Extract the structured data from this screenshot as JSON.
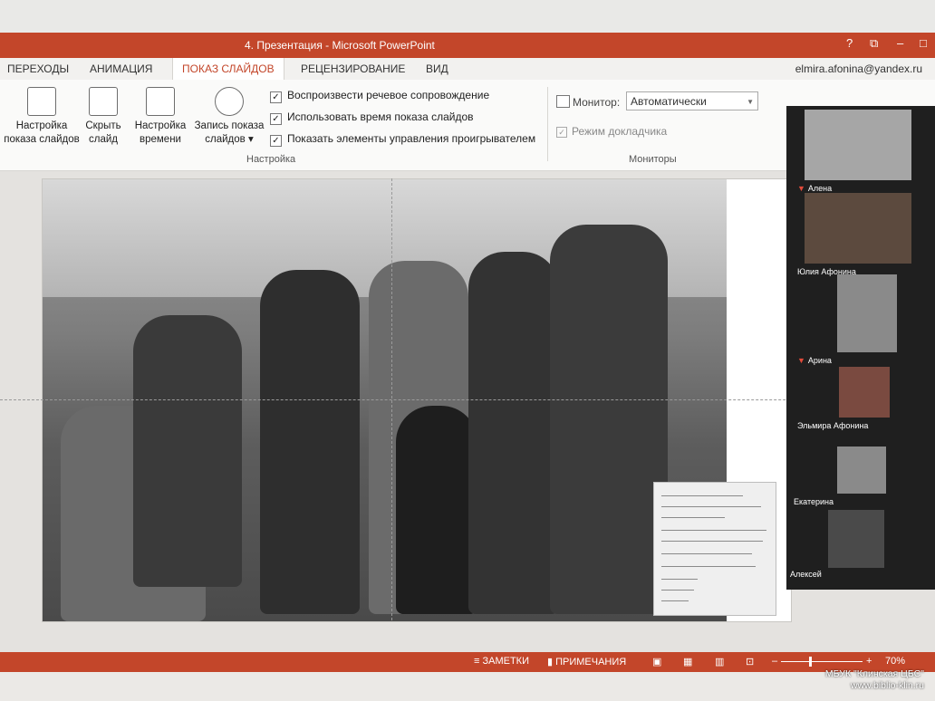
{
  "window": {
    "title": "4. Презентация -  Microsoft PowerPoint",
    "help": "?",
    "restore": "⧉",
    "minimize": "–",
    "close": "□"
  },
  "tabs": [
    {
      "label": "ПЕРЕХОДЫ"
    },
    {
      "label": "АНИМАЦИЯ"
    },
    {
      "label": "ПОКАЗ СЛАЙДОВ",
      "active": true
    },
    {
      "label": "РЕЦЕНЗИРОВАНИЕ"
    },
    {
      "label": "ВИД"
    }
  ],
  "user": "elmira.afonina@yandex.ru",
  "ribbon": {
    "buttons": [
      {
        "line1": "Настройка",
        "line2": "показа слайдов"
      },
      {
        "line1": "Скрыть",
        "line2": "слайд"
      },
      {
        "line1": "Настройка",
        "line2": "времени"
      },
      {
        "line1": "Запись показа",
        "line2": "слайдов ▾"
      }
    ],
    "checkboxes": [
      {
        "label": "Воспроизвести речевое сопровождение",
        "checked": true
      },
      {
        "label": "Использовать время показа слайдов",
        "checked": true
      },
      {
        "label": "Показать элементы управления проигрывателем",
        "checked": true
      }
    ],
    "group_setup": "Настройка",
    "monitor_label": "Монитор:",
    "monitor_value": "Автоматически",
    "presenter_view": "Режим докладчика",
    "group_monitors": "Мониторы"
  },
  "participants": [
    {
      "name": "Алена",
      "muted": true
    },
    {
      "name": "Юлия Афонина",
      "muted": false
    },
    {
      "name": "Арина",
      "muted": true
    },
    {
      "name": "Эльмира Афонина",
      "muted": false
    },
    {
      "name": "Екатерина",
      "muted": false
    },
    {
      "name": "Алексей",
      "muted": false
    }
  ],
  "status": {
    "notes": "ЗАМЕТКИ",
    "comments": "ПРИМЕЧАНИЯ",
    "zoom": "70%"
  },
  "watermark": {
    "line1": "МБУК \"Клинская ЦБС\"",
    "line2": "www.biblio-klin.ru"
  },
  "colors": {
    "accent": "#c3462a"
  }
}
